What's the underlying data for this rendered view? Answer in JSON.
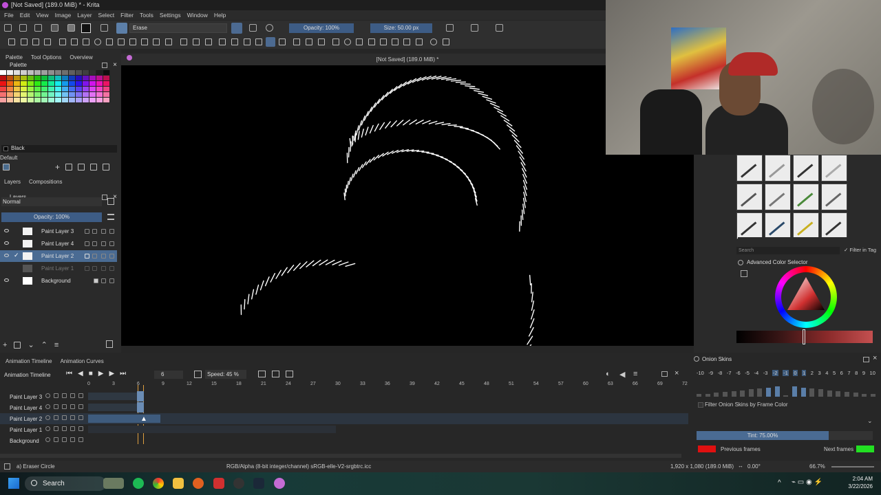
{
  "window": {
    "title": "[Not Saved]  (189.0 MiB) * - Krita"
  },
  "menu": [
    "File",
    "Edit",
    "View",
    "Image",
    "Layer",
    "Select",
    "Filter",
    "Tools",
    "Settings",
    "Window",
    "Help"
  ],
  "toolbar": {
    "blend_mode": "Erase",
    "opacity": "Opacity: 100%",
    "size": "Size: 50.00 px"
  },
  "left_tabs": [
    "Palette",
    "Tool Options",
    "Overview"
  ],
  "palette": {
    "title": "Palette",
    "current_color": "Black",
    "palette_name": "Default"
  },
  "layers_panel": {
    "tabs": [
      "Layers",
      "Compositions"
    ],
    "title": "Layers",
    "blend": "Normal",
    "opacity": "Opacity:  100%",
    "layers": [
      {
        "name": "Paint Layer 3"
      },
      {
        "name": "Paint Layer 4"
      },
      {
        "name": "Paint Layer 2",
        "selected": true
      },
      {
        "name": "Paint Layer 1",
        "hidden": true
      },
      {
        "name": "Background"
      }
    ]
  },
  "canvas": {
    "title": "[Not Saved]  (189.0 MiB) *"
  },
  "brush_panel": {
    "search_placeholder": "Search",
    "filter_in_tag": "Filter in Tag"
  },
  "color_selector": {
    "title": "Advanced Color Selector"
  },
  "timeline": {
    "tabs": [
      "Animation Timeline",
      "Animation Curves"
    ],
    "title": "Animation Timeline",
    "frame": "6",
    "speed": "Speed: 45 %",
    "ruler": [
      "0",
      "3",
      "6",
      "9",
      "12",
      "15",
      "18",
      "21",
      "24",
      "27",
      "30",
      "33",
      "36",
      "39",
      "42",
      "45",
      "48",
      "51",
      "54",
      "57",
      "60",
      "63",
      "66",
      "69",
      "72"
    ],
    "rows": [
      "Paint Layer 3",
      "Paint Layer 4",
      "Paint Layer 2",
      "Paint Layer 1",
      "Background"
    ]
  },
  "onion": {
    "title": "Onion Skins",
    "numbers": [
      "-10",
      "-9",
      "-8",
      "-7",
      "-6",
      "-5",
      "-4",
      "-3",
      "-2",
      "-1",
      "0",
      "1",
      "2",
      "3",
      "4",
      "5",
      "6",
      "7",
      "8",
      "9",
      "10"
    ],
    "filter_label": "Filter Onion Skins by Frame Color",
    "tint": "Tint: 75.00%",
    "previous": "Previous frames",
    "next": "Next frames",
    "previous_color": "#e01010",
    "next_color": "#22e022"
  },
  "status": {
    "tool": "a) Eraser Circle",
    "color_space": "RGB/Alpha (8-bit integer/channel)  sRGB-elle-V2-srgbtrc.icc",
    "dimensions": "1,920 x 1,080 (189.0 MiB)",
    "rotation": "0.00°",
    "zoom": "66.7%"
  },
  "taskbar": {
    "search": "Search",
    "time": "2:04 AM",
    "date": "3/22/2026"
  }
}
